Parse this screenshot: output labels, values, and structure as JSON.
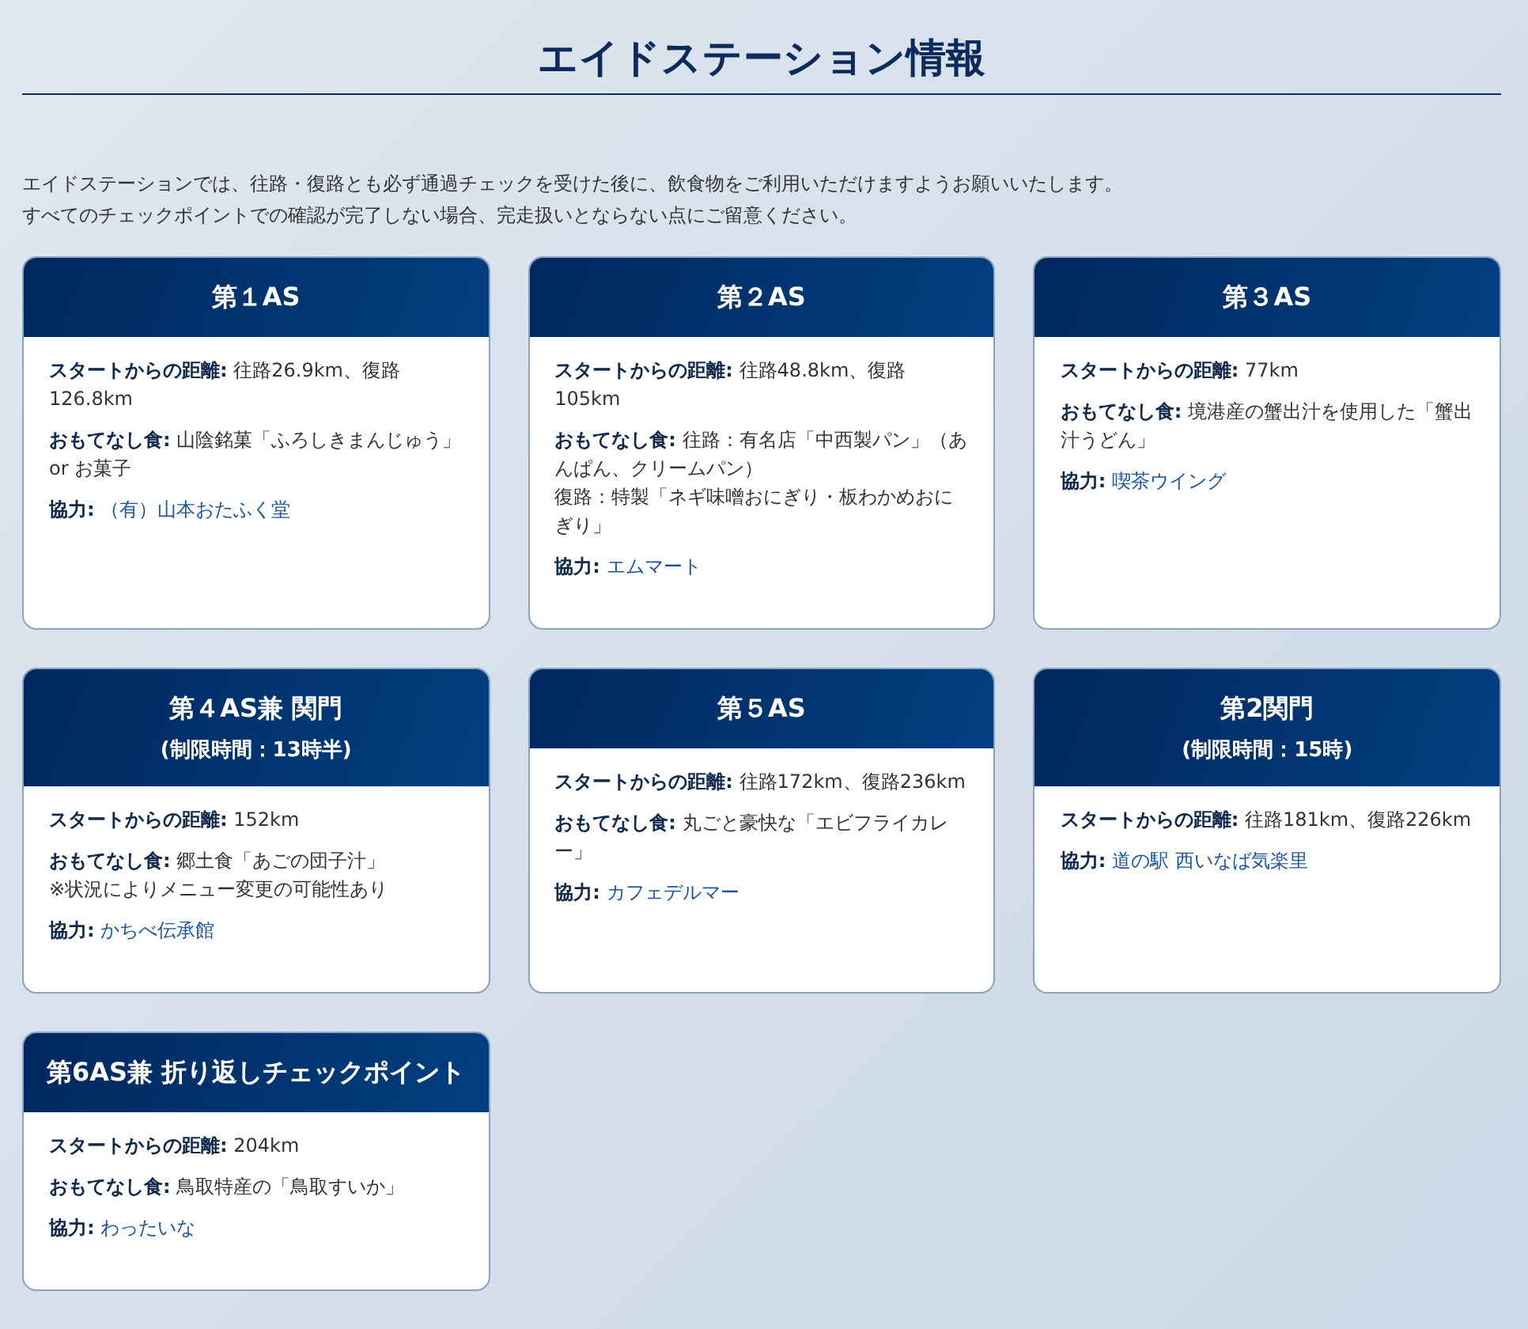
{
  "title": "エイドステーション情報",
  "intro": [
    "エイドステーションでは、往路・復路とも必ず通過チェックを受けた後に、飲食物をご利用いただけますようお願いいたします。",
    "すべてのチェックポイントでの確認が完了しない場合、完走扱いとならない点にご留意ください。"
  ],
  "stations": [
    {
      "title": "第１AS",
      "fields": [
        {
          "kind": "text",
          "label": "スタートからの距離:",
          "lines": [
            "往路26.9km、復路126.8km"
          ]
        },
        {
          "kind": "text",
          "label": "おもてなし食:",
          "lines": [
            "山陰銘菓「ふろしきまんじゅう」or お菓子"
          ]
        },
        {
          "kind": "link",
          "label": "協力:",
          "lines": [
            "（有）山本おたふく堂"
          ]
        }
      ]
    },
    {
      "title": "第２AS",
      "fields": [
        {
          "kind": "text",
          "label": "スタートからの距離:",
          "lines": [
            "往路48.8km、復路105km"
          ]
        },
        {
          "kind": "text",
          "label": "おもてなし食:",
          "lines": [
            "往路：有名店「中西製パン」（あんぱん、クリームパン）",
            "復路：特製「ネギ味噌おにぎり・板わかめおにぎり」"
          ]
        },
        {
          "kind": "link",
          "label": "協力:",
          "lines": [
            "エムマート"
          ]
        }
      ]
    },
    {
      "title": "第３AS",
      "fields": [
        {
          "kind": "text",
          "label": "スタートからの距離:",
          "lines": [
            "77km"
          ]
        },
        {
          "kind": "text",
          "label": "おもてなし食:",
          "lines": [
            "境港産の蟹出汁を使用した「蟹出汁うどん」"
          ]
        },
        {
          "kind": "link",
          "label": "協力:",
          "lines": [
            "喫茶ウイング"
          ]
        }
      ]
    },
    {
      "title": "第４AS兼 関門",
      "subtitle": "(制限時間：13時半)",
      "fields": [
        {
          "kind": "text",
          "label": "スタートからの距離:",
          "lines": [
            "152km"
          ]
        },
        {
          "kind": "text",
          "label": "おもてなし食:",
          "lines": [
            "郷土食「あごの団子汁」",
            "※状況によりメニュー変更の可能性あり"
          ]
        },
        {
          "kind": "link",
          "label": "協力:",
          "lines": [
            "かちべ伝承館"
          ]
        }
      ]
    },
    {
      "title": "第５AS",
      "fields": [
        {
          "kind": "text",
          "label": "スタートからの距離:",
          "lines": [
            "往路172km、復路236km"
          ]
        },
        {
          "kind": "text",
          "label": "おもてなし食:",
          "lines": [
            "丸ごと豪快な「エビフライカレー」"
          ]
        },
        {
          "kind": "link",
          "label": "協力:",
          "lines": [
            "カフェデルマー"
          ]
        }
      ]
    },
    {
      "title": "第2関門",
      "subtitle": "(制限時間：15時)",
      "fields": [
        {
          "kind": "text",
          "label": "スタートからの距離:",
          "lines": [
            "往路181km、復路226km"
          ]
        },
        {
          "kind": "link",
          "label": "協力:",
          "lines": [
            "道の駅 西いなば気楽里"
          ]
        }
      ]
    },
    {
      "title": "第6AS兼 折り返しチェックポイント",
      "fields": [
        {
          "kind": "text",
          "label": "スタートからの距離:",
          "lines": [
            "204km"
          ]
        },
        {
          "kind": "text",
          "label": "おもてなし食:",
          "lines": [
            "鳥取特産の「鳥取すいか」"
          ]
        },
        {
          "kind": "link",
          "label": "協力:",
          "lines": [
            "わったいな"
          ]
        }
      ]
    }
  ]
}
